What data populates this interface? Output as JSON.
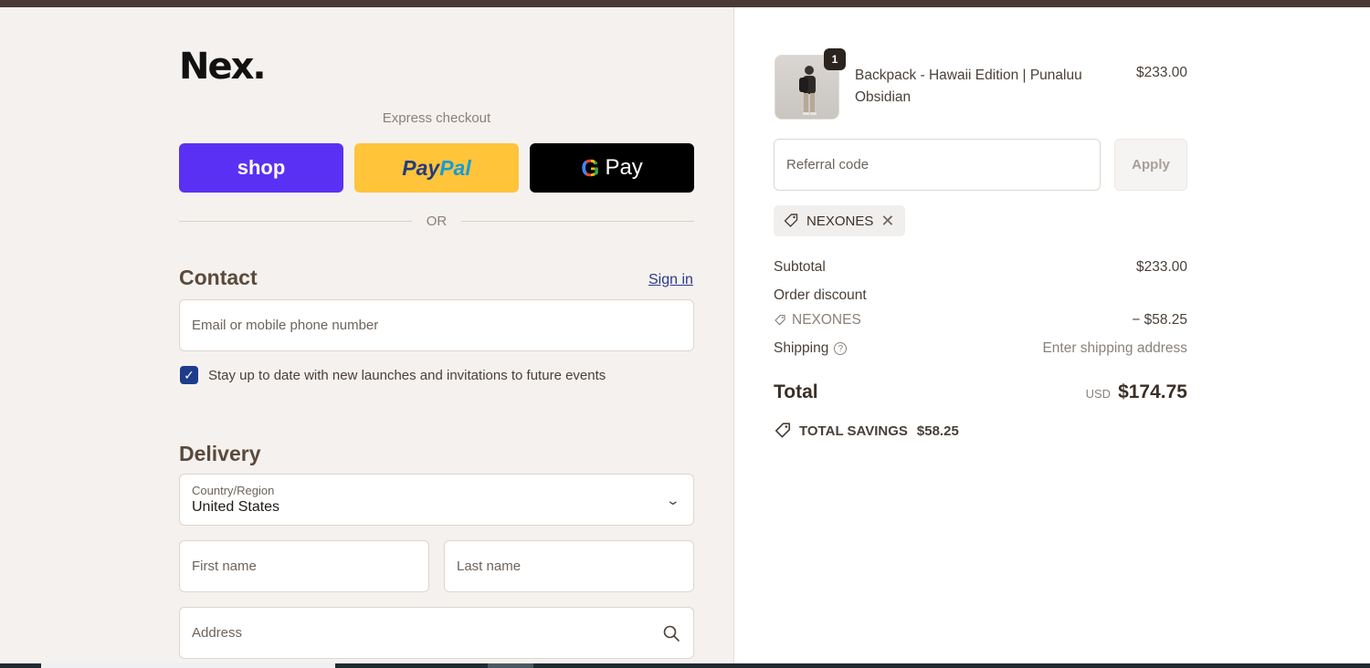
{
  "brand": {
    "logo_text": "Nex."
  },
  "express": {
    "label": "Express checkout",
    "shop_label": "shop",
    "paypal_pay": "Pay",
    "paypal_pal": "Pal",
    "gpay_g": "G",
    "gpay_label": "Pay",
    "or_label": "OR"
  },
  "contact": {
    "title": "Contact",
    "signin_label": "Sign in",
    "email_placeholder": "Email or mobile phone number",
    "newsletter_label": "Stay up to date with new launches and invitations to future events",
    "newsletter_checked": true
  },
  "delivery": {
    "title": "Delivery",
    "country_caption": "Country/Region",
    "country_value": "United States",
    "first_name_placeholder": "First name",
    "last_name_placeholder": "Last name",
    "address_placeholder": "Address"
  },
  "order": {
    "item": {
      "quantity": "1",
      "name": "Backpack - Hawaii Edition | Punaluu Obsidian",
      "price": "$233.00"
    },
    "referral_placeholder": "Referral code",
    "apply_label": "Apply",
    "applied_code": "NEXONES",
    "subtotal_label": "Subtotal",
    "subtotal_value": "$233.00",
    "discount_label": "Order discount",
    "discount_code": "NEXONES",
    "discount_value": "− $58.25",
    "shipping_label": "Shipping",
    "shipping_value": "Enter shipping address",
    "total_label": "Total",
    "total_currency": "USD",
    "total_value": "$174.75",
    "savings_label": "TOTAL SAVINGS",
    "savings_value": "$58.25"
  },
  "colors": {
    "shop_button": "#5a31f4",
    "paypal_button": "#ffc439",
    "gpay_button": "#000000",
    "checkbox": "#1d3d8c",
    "link": "#2b3a8a"
  }
}
